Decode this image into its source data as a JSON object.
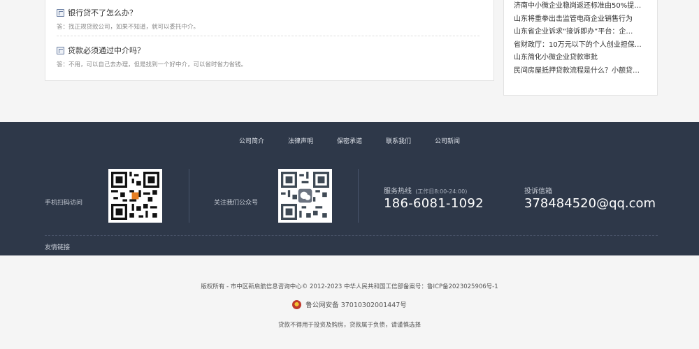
{
  "qa": [
    {
      "question": "银行贷不了怎么办？",
      "answer": "答：找正规贷款公司，如果不知道，就可以委托中介。"
    },
    {
      "question": "贷款必须通过中介吗？",
      "answer": "答：不用，可以自己去办理，但是找到一个好中介，可以省时省力省钱。"
    }
  ],
  "news": [
    "济南中小微企业稳岗返还标准由50%提…",
    "山东将重拳出击监管电商企业销售行为",
    "山东省企业诉求“接诉即办”平台：企…",
    "省财政厅：10万元以下的个人创业担保…",
    "山东简化小微企业贷款审批",
    "民间房屋抵押贷款流程是什么？小额贷…"
  ],
  "footer": {
    "nav": [
      "公司简介",
      "法律声明",
      "保密承诺",
      "联系我们",
      "公司新闻"
    ],
    "mobile_label": "手机扫码访问",
    "wechat_label": "关注我们公众号",
    "hotline_title": "服务热线",
    "hotline_hours": "(工作日8:00-24:00)",
    "hotline_number": "186-6081-1092",
    "mail_title": "投诉信箱",
    "mail_value": "378484520@qq.com",
    "links_label": "友情链接"
  },
  "bottom": {
    "copyright": "版权所有 - 市中区新启航信息咨询中心© 2012-2023 中华人民共和国工信部备案号：鲁ICP备2023025906号-1",
    "police": "鲁公网安备 37010302001447号",
    "warning": "贷款不得用于投资及购房，贷款属于负债，请谨慎选择"
  },
  "icons": {
    "question": "question-icon",
    "police": "police-badge-icon",
    "qr_mobile": "qr-code-mobile",
    "qr_wechat": "qr-code-wechat"
  }
}
